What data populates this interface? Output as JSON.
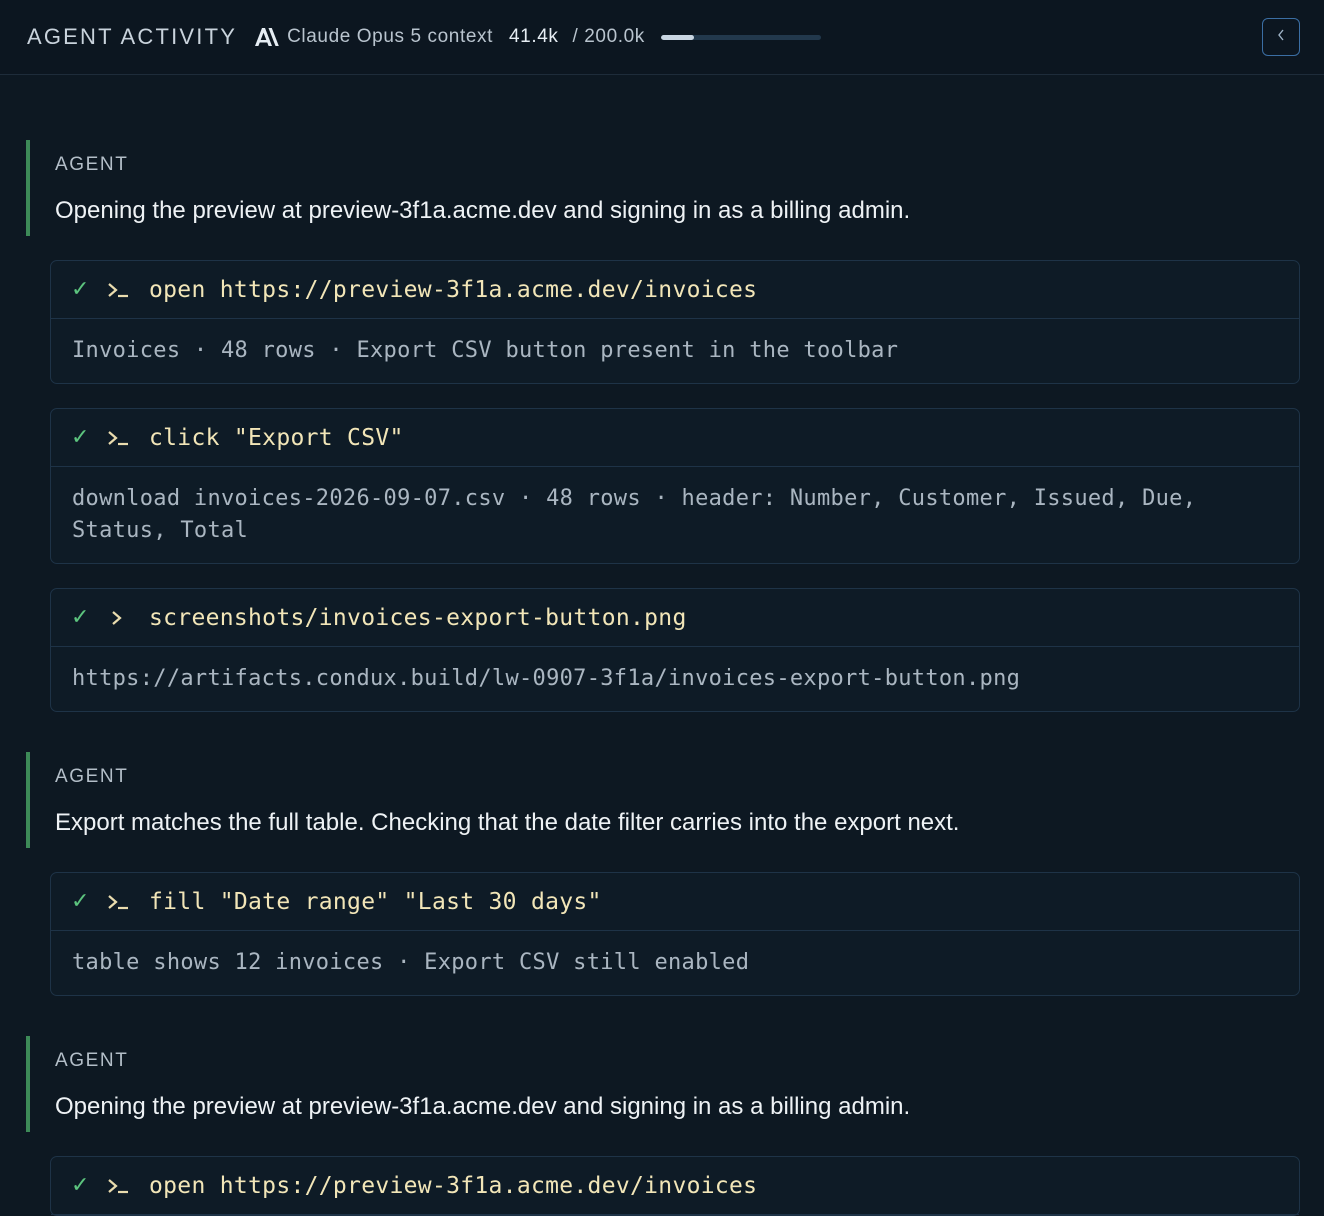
{
  "header": {
    "title": "AGENT ACTIVITY",
    "model": "Claude Opus 5 context",
    "context_used": "41.4k",
    "context_total": "/ 200.0k",
    "context_fraction": 0.207
  },
  "feed": [
    {
      "agent_label": "AGENT",
      "agent_text": "Opening the preview at preview-3f1a.acme.dev and signing in as a billing admin.",
      "tools": [
        {
          "icon": "terminal-prompt-icon",
          "command": "open https://preview-3f1a.acme.dev/invoices",
          "output": "Invoices · 48 rows · Export CSV button present in the toolbar"
        },
        {
          "icon": "terminal-prompt-icon",
          "command": "click \"Export CSV\"",
          "output": "download invoices-2026-09-07.csv · 48 rows · header: Number, Customer, Issued, Due, Status, Total"
        },
        {
          "icon": "chevron-right-icon",
          "command": "screenshots/invoices-export-button.png",
          "output": "https://artifacts.condux.build/lw-0907-3f1a/invoices-export-button.png"
        }
      ]
    },
    {
      "agent_label": "AGENT",
      "agent_text": "Export matches the full table. Checking that the date filter carries into the export next.",
      "tools": [
        {
          "icon": "terminal-prompt-icon",
          "command": "fill \"Date range\" \"Last 30 days\"",
          "output": "table shows 12 invoices · Export CSV still enabled"
        }
      ]
    },
    {
      "agent_label": "AGENT",
      "agent_text": "Opening the preview at preview-3f1a.acme.dev and signing in as a billing admin.",
      "tools": [
        {
          "icon": "terminal-prompt-icon",
          "command": "open https://preview-3f1a.acme.dev/invoices",
          "output": ""
        }
      ]
    }
  ],
  "colors": {
    "background": "#0d1822",
    "accent_green": "#3d8a58",
    "check_green": "#5cc47e",
    "command_yellow": "#f2e6b8",
    "border_blue": "#3b6ea3"
  }
}
